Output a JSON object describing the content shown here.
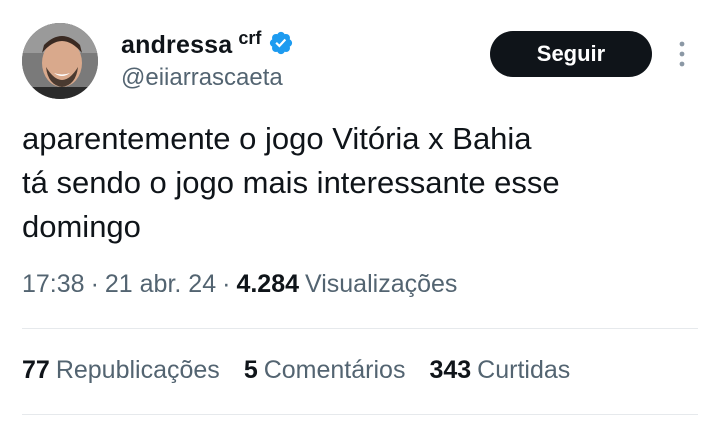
{
  "author": {
    "display_name": "andressa",
    "display_suffix": "crf",
    "handle": "@eiiarrascaeta",
    "verified": true,
    "avatar_icon": "profile-photo"
  },
  "follow_button": {
    "label": "Seguir"
  },
  "more_menu_icon": "more-vertical-icon",
  "tweet": {
    "lines": [
      "aparentemente o jogo Vitória x Bahia",
      "tá sendo o jogo mais interessante esse",
      "domingo"
    ]
  },
  "meta": {
    "time": "17:38",
    "separator": "·",
    "date": "21 abr. 24",
    "views_count": "4.284",
    "views_label": "Visualizações"
  },
  "stats": {
    "reposts_count": "77",
    "reposts_label": "Republicações",
    "comments_count": "5",
    "comments_label": "Comentários",
    "likes_count": "343",
    "likes_label": "Curtidas"
  },
  "colors": {
    "text": "#0f1419",
    "secondary": "#536471",
    "verified": "#1d9bf0",
    "button_bg": "#0f1419",
    "divider": "#e6e9ec"
  }
}
